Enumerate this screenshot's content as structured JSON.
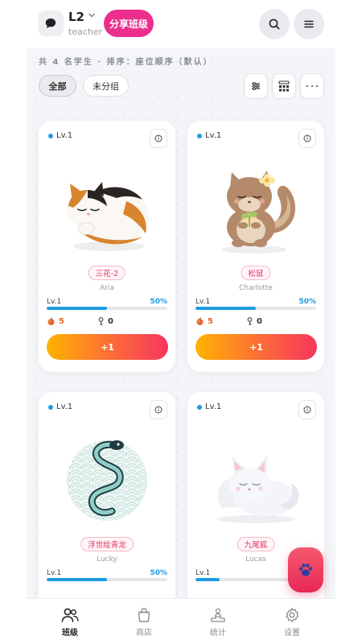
{
  "header": {
    "class_name": "L2",
    "role": "teacher",
    "share_label": "分享班级",
    "icons": {
      "chat": "chat-bubble-icon",
      "search": "search-icon",
      "menu": "menu-icon"
    }
  },
  "summary": "共 4 名学生 · 排序：座位顺序（默认）",
  "filters": [
    {
      "label": "全部",
      "active": true
    },
    {
      "label": "未分组",
      "active": false
    }
  ],
  "tools": [
    "sliders-icon",
    "seat-grid-icon",
    "more-icon"
  ],
  "students": [
    {
      "level": "Lv.1",
      "pet": "三花-2",
      "name": "Aria",
      "progress_label": "Lv.1",
      "progress_pct": "50%",
      "progress": 0.5,
      "food": "5",
      "keys": "0",
      "action": "+1",
      "art": "calico-cat"
    },
    {
      "level": "Lv.1",
      "pet": "松鼠",
      "name": "Charlotte",
      "progress_label": "Lv.1",
      "progress_pct": "50%",
      "progress": 0.5,
      "food": "5",
      "keys": "0",
      "action": "+1",
      "art": "squirrel"
    },
    {
      "level": "Lv.1",
      "pet": "浮世绘青龙",
      "name": "Lucky",
      "progress_label": "Lv.1",
      "progress_pct": "50%",
      "progress": 0.5,
      "art": "ukiyoe-dragon"
    },
    {
      "level": "Lv.1",
      "pet": "九尾狐",
      "name": "Lucas",
      "progress_label": "Lv.1",
      "progress": 0.2,
      "art": "white-fox"
    }
  ],
  "nav": [
    {
      "label": "班级",
      "icon": "people-icon",
      "active": true
    },
    {
      "label": "商店",
      "icon": "shopping-bag-icon",
      "active": false
    },
    {
      "label": "统计",
      "icon": "podium-icon",
      "active": false
    },
    {
      "label": "设置",
      "icon": "gear-icon",
      "active": false
    }
  ],
  "fab_icon": "paw-icon",
  "colors": {
    "accent_pink": "#ec2f8d",
    "progress_blue": "#1e9be0",
    "tag_red": "#e0365f"
  }
}
